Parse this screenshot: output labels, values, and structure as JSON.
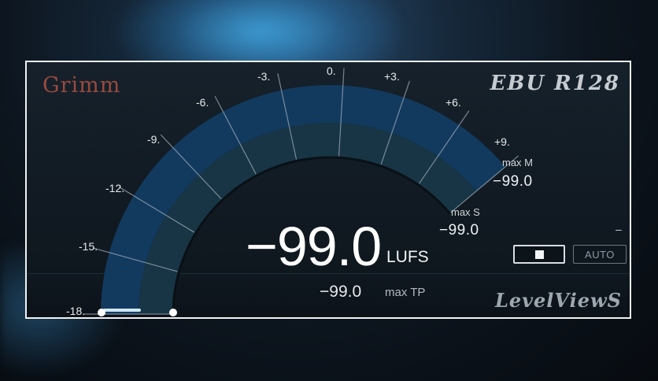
{
  "header": {
    "brand": "Grimm",
    "standard": "EBU R128",
    "product": "LevelViewS"
  },
  "gauge": {
    "ticks": [
      {
        "id": "m18",
        "label": "-18."
      },
      {
        "id": "m15",
        "label": "-15."
      },
      {
        "id": "m12",
        "label": "-12."
      },
      {
        "id": "m9",
        "label": "-9."
      },
      {
        "id": "m6",
        "label": "-6."
      },
      {
        "id": "m3",
        "label": "-3."
      },
      {
        "id": "z0",
        "label": "0."
      },
      {
        "id": "p3",
        "label": "+3."
      },
      {
        "id": "p6",
        "label": "+6."
      },
      {
        "id": "p9",
        "label": "+9."
      }
    ],
    "colors": {
      "outer_ring": "#123a5e",
      "inner_ring": "#173545",
      "tick_line": "#9aa8b4"
    }
  },
  "readouts": {
    "max_m_label": "max M",
    "max_m_value": "−99.0",
    "max_s_label": "max S",
    "max_s_value": "−99.0",
    "integrated_value": "−99.0",
    "integrated_unit": "LUFS",
    "max_tp_value": "−99.0",
    "max_tp_label": "max TP",
    "side_dash": "–"
  },
  "controls": {
    "stop_icon": "stop-square-icon",
    "auto_label": "AUTO"
  }
}
